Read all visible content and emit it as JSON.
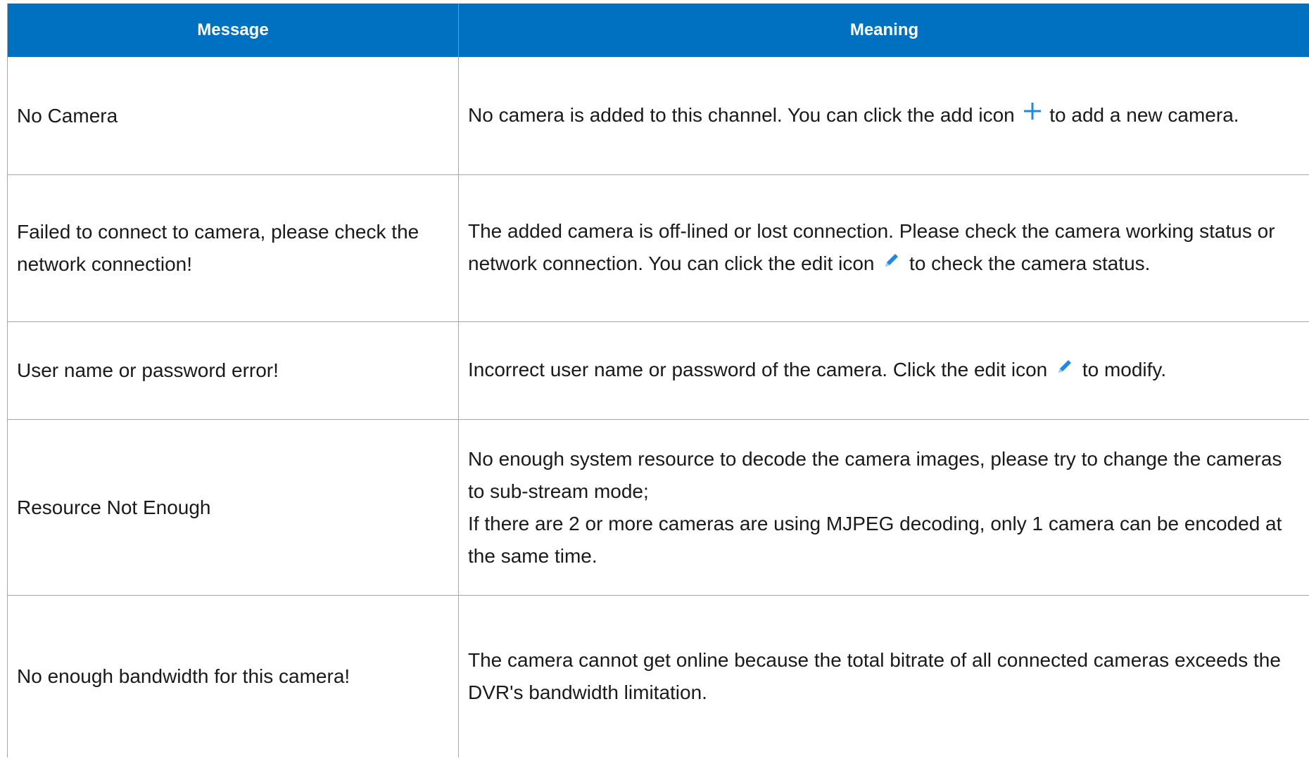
{
  "table": {
    "headers": {
      "message": "Message",
      "meaning": "Meaning"
    },
    "rows": [
      {
        "message": "No Camera",
        "meaning_before_icon": "No camera is added to this channel. You can click the add icon",
        "icon": "add-plus-icon",
        "meaning_after_icon": "to add a new camera."
      },
      {
        "message": "Failed to connect to camera, please check the network connection!",
        "meaning_before_icon": "The added camera is off-lined or lost connection. Please check the camera working status or network connection. You can click the edit icon",
        "icon": "edit-pencil-icon",
        "meaning_after_icon": "to check the camera status."
      },
      {
        "message": "User name or password error!",
        "meaning_before_icon": "Incorrect user name or password of the camera. Click the edit icon",
        "icon": "edit-pencil-icon",
        "meaning_after_icon": "to modify."
      },
      {
        "message": "Resource Not Enough",
        "meaning_line1": "No enough system resource to decode the camera images, please try to change the cameras to sub-stream mode;",
        "meaning_line2": "If there are 2 or more cameras are using MJPEG decoding, only 1 camera can be encoded at the same time."
      },
      {
        "message": "No enough bandwidth for this camera!",
        "meaning": "The camera cannot get online because the total bitrate of all connected cameras exceeds the DVR's bandwidth limitation."
      }
    ]
  },
  "colors": {
    "header_bg": "#0070c0",
    "header_text": "#ffffff",
    "border": "#a6a6a6",
    "icon_blue": "#1e88e5"
  }
}
